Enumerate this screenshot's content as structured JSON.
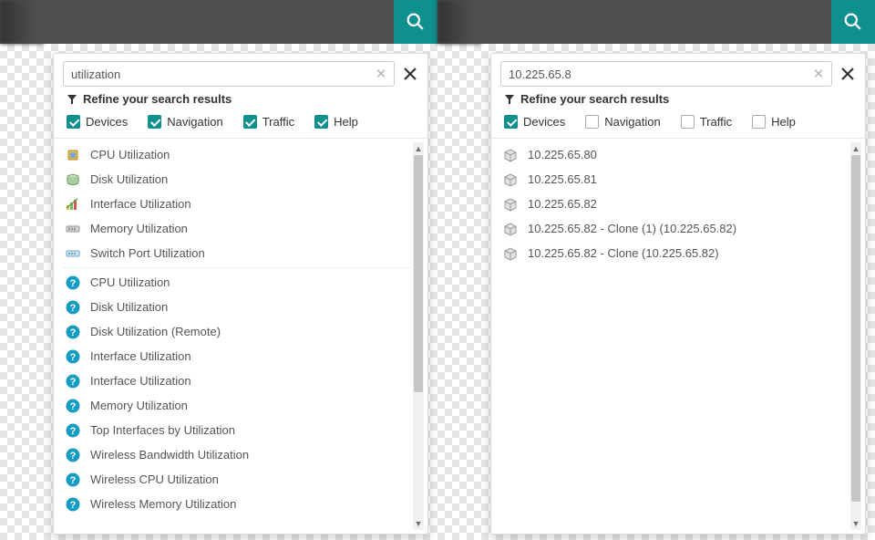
{
  "colors": {
    "accent": "#0e8f90",
    "topbar": "#4e4e4e"
  },
  "refine_label": "Refine your search results",
  "filter_labels": {
    "devices": "Devices",
    "navigation": "Navigation",
    "traffic": "Traffic",
    "help": "Help"
  },
  "panels": [
    {
      "search_value": "utilization",
      "filters": {
        "devices": true,
        "navigation": true,
        "traffic": true,
        "help": true
      },
      "scroll_thumb_height": 260,
      "results": [
        {
          "icon": "cpu",
          "label": "CPU Utilization"
        },
        {
          "icon": "disk",
          "label": "Disk Utilization"
        },
        {
          "icon": "iface",
          "label": "Interface Utilization"
        },
        {
          "icon": "mem",
          "label": "Memory Utilization"
        },
        {
          "icon": "switch",
          "label": "Switch Port Utilization"
        },
        {
          "sep": true
        },
        {
          "icon": "help",
          "label": "CPU Utilization"
        },
        {
          "icon": "help",
          "label": "Disk Utilization"
        },
        {
          "icon": "help",
          "label": "Disk Utilization (Remote)"
        },
        {
          "icon": "help",
          "label": "Interface Utilization"
        },
        {
          "icon": "help",
          "label": "Interface Utilization"
        },
        {
          "icon": "help",
          "label": "Memory Utilization"
        },
        {
          "icon": "help",
          "label": "Top Interfaces by Utilization"
        },
        {
          "icon": "help",
          "label": "Wireless Bandwidth Utilization"
        },
        {
          "icon": "help",
          "label": "Wireless CPU Utilization"
        },
        {
          "icon": "help",
          "label": "Wireless Memory Utilization"
        }
      ]
    },
    {
      "search_value": "10.225.65.8",
      "filters": {
        "devices": true,
        "navigation": false,
        "traffic": false,
        "help": false
      },
      "scroll_thumb_height": 380,
      "results": [
        {
          "icon": "device",
          "label": "10.225.65.80"
        },
        {
          "icon": "device",
          "label": "10.225.65.81"
        },
        {
          "icon": "device",
          "label": "10.225.65.82"
        },
        {
          "icon": "device",
          "label": "10.225.65.82 - Clone (1) (10.225.65.82)"
        },
        {
          "icon": "device",
          "label": "10.225.65.82 - Clone (10.225.65.82)"
        }
      ]
    }
  ]
}
